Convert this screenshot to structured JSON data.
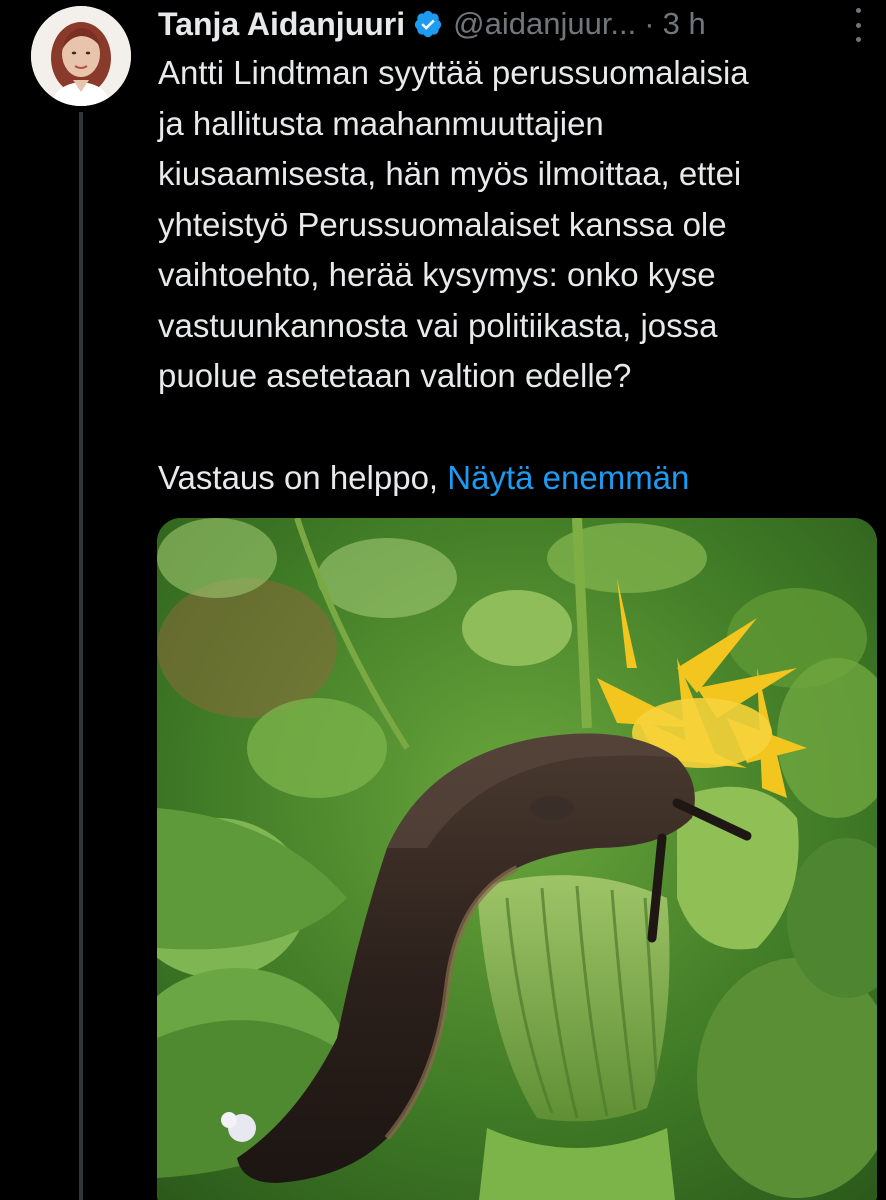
{
  "tweet": {
    "author_name": "Tanja Aidanjuuri",
    "handle": "@aidanjuur...",
    "separator": "·",
    "time": "3 h",
    "text": "Antti Lindtman syyttää perussuomalaisia\nja hallitusta maahanmuuttajien\nkiusaamisesta, hän myös ilmoittaa, ettei\nyhteistyö Perussuomalaiset kanssa ole\nvaihtoehto, herää kysymys: onko kyse\nvastuunkannosta vai politiikasta, jossa\npuolue asetetaan valtion edelle?",
    "lead_text": "Vastaus on helppo, ",
    "show_more_label": "Näytä enemmän"
  },
  "colors": {
    "background": "#000000",
    "text": "#e7e9ea",
    "secondary_text": "#71767b",
    "link": "#1d9bf0",
    "verified_badge": "#1d9bf0",
    "thread_line": "#333639"
  },
  "icons": {
    "verified": "verified-badge-icon",
    "more": "more-options-icon"
  }
}
